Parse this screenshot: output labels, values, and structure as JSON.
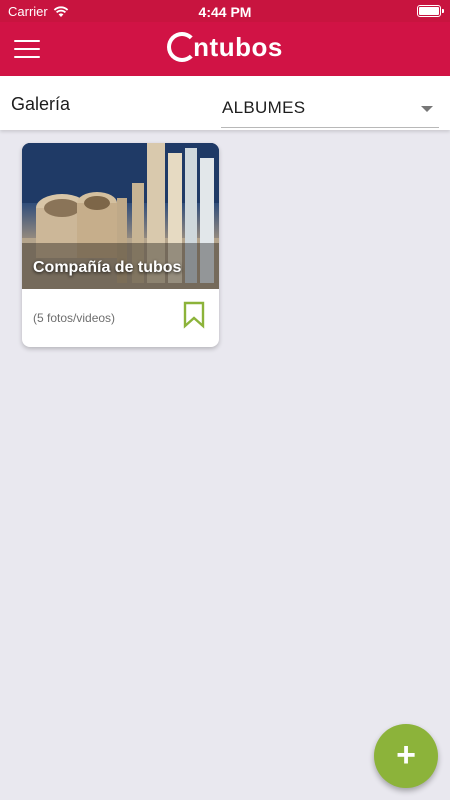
{
  "status_bar": {
    "carrier": "Carrier",
    "time": "4:44 PM",
    "wifi_icon": "wifi-icon",
    "battery_icon": "battery-icon"
  },
  "header": {
    "menu_icon": "hamburger-menu-icon",
    "logo_text": "ntubos",
    "brand_color": "#d11345"
  },
  "filter": {
    "label": "Galería",
    "selected": "ALBUMES"
  },
  "albums": [
    {
      "title": "Compañía de tubos",
      "count_text": "(5 fotos/videos)",
      "bookmark_icon": "bookmark-icon"
    }
  ],
  "fab": {
    "label": "+",
    "color": "#8cb33a"
  }
}
